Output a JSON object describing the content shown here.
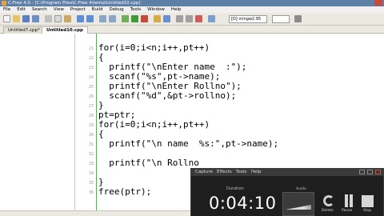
{
  "window": {
    "title": "C-Free 4.0 - [C:\\Program Files\\C-Free 4\\temp\\Untitled10.cpp]"
  },
  "menu": [
    "File",
    "Edit",
    "Search",
    "View",
    "Project",
    "Build",
    "Debug",
    "Tools",
    "Window",
    "Help"
  ],
  "toolbar": {
    "combo_value": "[D] mingw2.95"
  },
  "tabs": [
    {
      "label": "Untitled7.cpp*",
      "active": false
    },
    {
      "label": "Untitled10.cpp",
      "active": true
    }
  ],
  "editor": {
    "line_numbers": [
      "21",
      "22",
      "23",
      "24",
      "25",
      "26",
      "27",
      "28",
      "29",
      "30",
      "31",
      "32",
      "33",
      "34",
      "35",
      "36"
    ],
    "lines": [
      "for(i=0;i<n;i++,pt++)",
      "{",
      "  printf(\"\\nEnter name  :\");",
      "  scanf(\"%s\",pt->name);",
      "  printf(\"\\nEnter Rollno\");",
      "  scanf(\"%d\",&pt->rollno);",
      "}",
      "pt=ptr;",
      "for(i=0;i<n;i++,pt++)",
      "{",
      "  printf(\"\\n name  %s:\",pt->name);",
      "",
      "  printf(\"\\n Rollno",
      "",
      "}",
      "free(ptr);"
    ]
  },
  "recorder": {
    "menu": [
      "Capture",
      "Effects",
      "Tools",
      "Help"
    ],
    "duration_label": "Duration",
    "duration": "0:04:10",
    "audio_label": "Audio",
    "delete_label": "Delete",
    "pause_label": "Pause",
    "stop_label": "Stop"
  },
  "colors": {
    "titlebar": "#5e7fa6",
    "fold_line": "#3ec23a",
    "string": "#1a3fbf",
    "number": "#8b2aa9"
  }
}
